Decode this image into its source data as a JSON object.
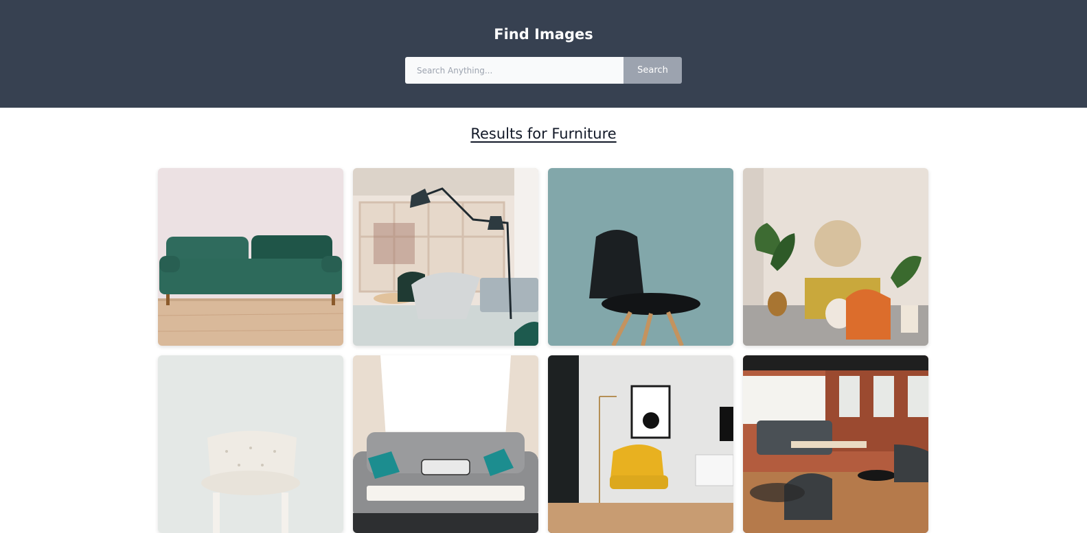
{
  "header": {
    "title": "Find Images",
    "search_placeholder": "Search Anything...",
    "search_value": "",
    "search_button": "Search",
    "background_color": "#374151"
  },
  "results": {
    "heading": "Results for Furniture"
  },
  "images": [
    {
      "subject": "green-velvet-sofa"
    },
    {
      "subject": "office-lounge-with-floor-lamp"
    },
    {
      "subject": "black-chair-on-teal"
    },
    {
      "subject": "living-room-orange-armchair"
    },
    {
      "subject": "white-tufted-chair"
    },
    {
      "subject": "grey-sofa-with-cushions"
    },
    {
      "subject": "yellow-armchair-room"
    },
    {
      "subject": "loft-lounge-grey-sofa"
    }
  ]
}
